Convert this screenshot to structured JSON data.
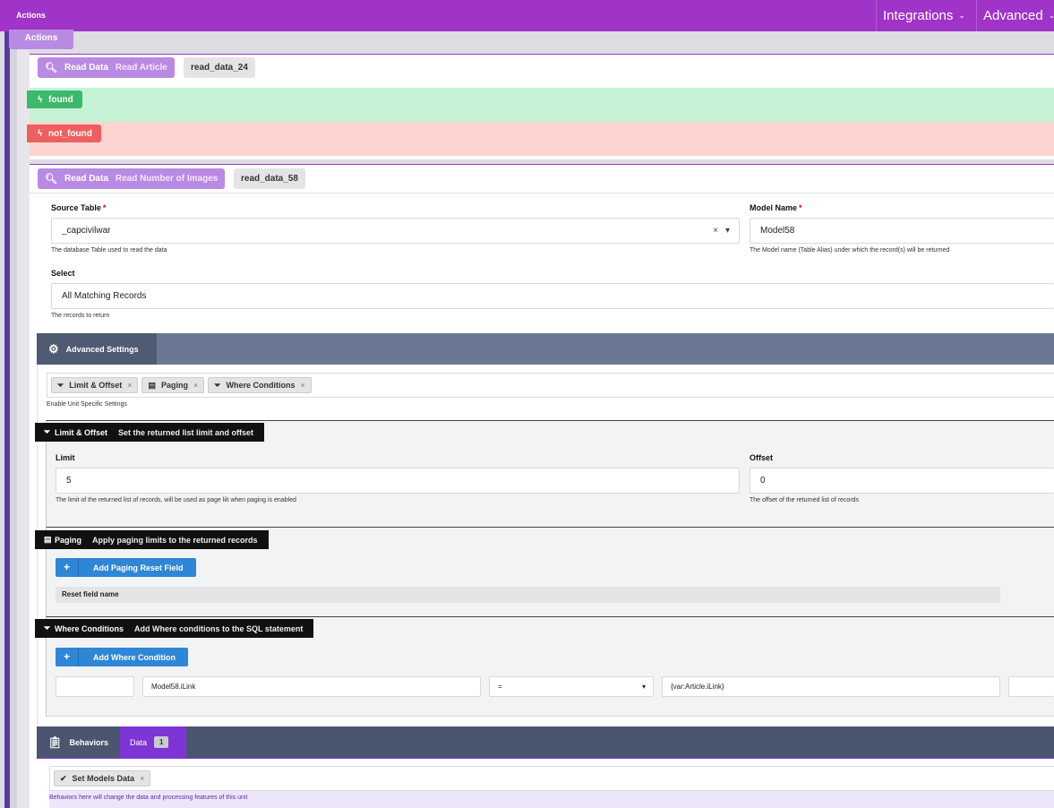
{
  "topbar": {
    "title": "Actions",
    "nav": [
      {
        "label": "Integrations"
      },
      {
        "label": "Advanced"
      }
    ],
    "chev": "⌄"
  },
  "actions_tab": "Actions",
  "unit1": {
    "type": "Read Data",
    "name": "Read Article",
    "id": "read_data_24"
  },
  "events": [
    {
      "label": "found",
      "color": "#3cb96a",
      "bg": "#c6f2d6"
    },
    {
      "label": "not_found",
      "color": "#ee5f5f",
      "bg": "#fdd4d0"
    }
  ],
  "unit2": {
    "type": "Read Data",
    "name": "Read Number of Images",
    "id": "read_data_58",
    "source_table": {
      "label": "Source Table",
      "value": "_capcivilwar",
      "help": "The database Table used to read the data",
      "clear": "×",
      "arrow": "▾"
    },
    "model_name": {
      "label": "Model Name",
      "value": "Model58",
      "help": "The Model name (Table Alias) under which the record(s) will be returned"
    },
    "select": {
      "label": "Select",
      "value": "All Matching Records",
      "help": "The records to return"
    },
    "required_mark": "*"
  },
  "advanced": {
    "title": "Advanced Settings",
    "pills": [
      {
        "label": "Limit & Offset"
      },
      {
        "label": "Paging"
      },
      {
        "label": "Where Conditions"
      }
    ],
    "pill_remove": "×",
    "help": "Enable Unit Specific Settings"
  },
  "limit_offset": {
    "title": "Limit & Offset",
    "subtitle": "Set the returned list limit and offset",
    "limit": {
      "label": "Limit",
      "value": "5",
      "help": "The limit of the returned list of records, will be used as page liit when paging is enabled"
    },
    "offset": {
      "label": "Offset",
      "value": "0",
      "help": "The offset of the returned list of records"
    }
  },
  "paging": {
    "title": "Paging",
    "subtitle": "Apply paging limits to the returned records",
    "button": "Add Paging Reset Field",
    "column": "Reset field name"
  },
  "where": {
    "title": "Where Conditions",
    "subtitle": "Add Where conditions to the SQL statement",
    "button": "Add Where Condition",
    "row": {
      "field": "Model58.iLink",
      "operator": "=",
      "value": "{var:Article.iLink}",
      "arrow": "▾"
    }
  },
  "behaviors": {
    "title": "Behaviors",
    "tab": "Data",
    "count": "1",
    "pill": "Set Models Data",
    "pill_remove": "×",
    "help": "Behaviors here will change the data and processing features of this unit"
  },
  "colors": {
    "accent": "#a033c8",
    "blue": "#2e86d6",
    "slate": "#6b7893"
  }
}
